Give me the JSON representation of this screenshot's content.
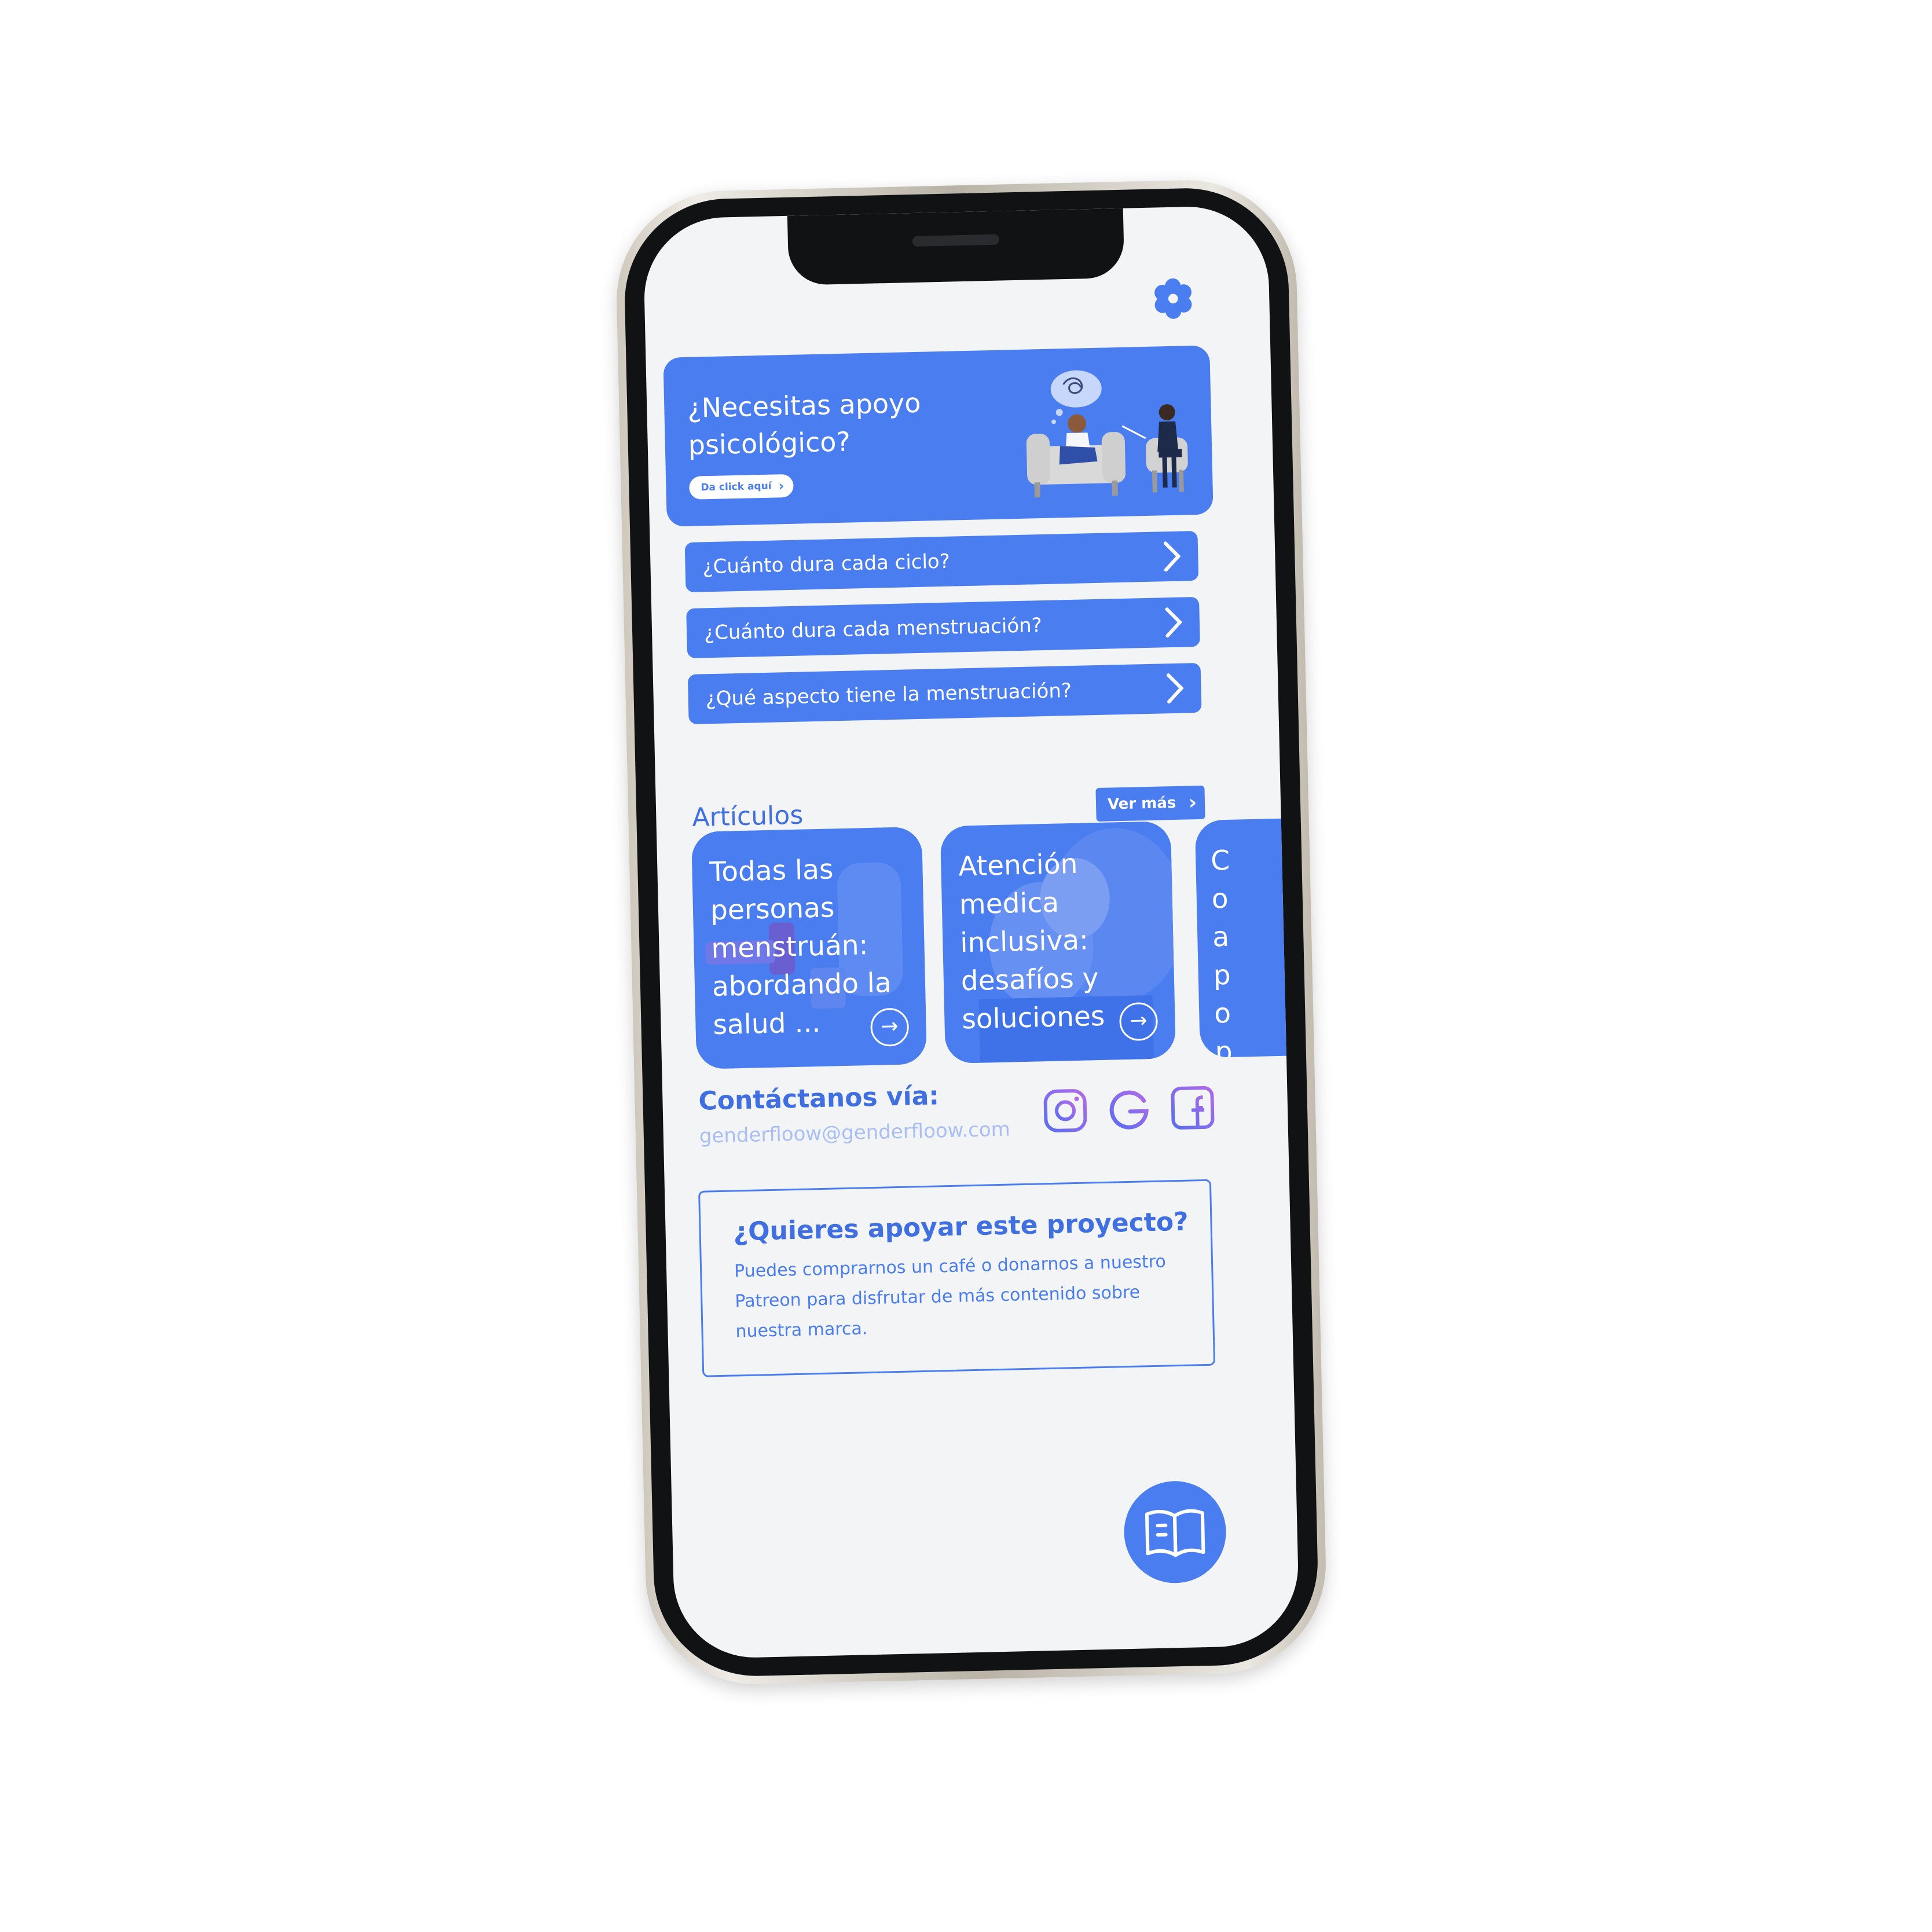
{
  "hero": {
    "title": "¿Necesitas apoyo psicológico?",
    "button_label": "Da click aquí"
  },
  "faq": [
    {
      "label": "¿Cuánto dura cada ciclo?"
    },
    {
      "label": "¿Cuánto dura cada menstruación?"
    },
    {
      "label": "¿Qué aspecto tiene la menstruación?"
    }
  ],
  "articles": {
    "title": "Artículos",
    "see_more": "Ver más",
    "cards": [
      {
        "text": "Todas las personas menstruán: abordando la salud ..."
      },
      {
        "text": "Atención medica inclusiva: desafíos y soluciones"
      },
      {
        "text": "Co ap op ges me"
      }
    ]
  },
  "contact": {
    "title": "Contáctanos vía:",
    "email": "genderfloow@genderfloow.com",
    "icons": [
      "instagram-icon",
      "google-icon",
      "facebook-icon"
    ]
  },
  "support": {
    "title": "¿Quieres apoyar este proyecto?",
    "body": "Puedes comprarnos un café o donarnos a nuestro Patreon para disfrutar de más contenido sobre nuestra marca."
  },
  "colors": {
    "primary": "#4a7df0",
    "heading": "#3f6fe0",
    "email": "#a9bff3",
    "screen_bg": "#f3f4f6"
  }
}
